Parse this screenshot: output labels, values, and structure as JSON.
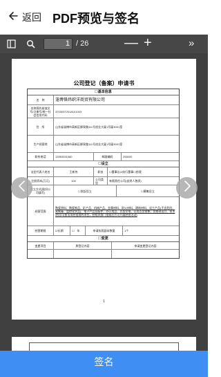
{
  "header": {
    "back_label": "返回",
    "title": "PDF预览与签名"
  },
  "toolbar": {
    "page_current": "1",
    "page_total": "/ 26",
    "zoom_out": "—",
    "zoom_in": "+",
    "more": "»"
  },
  "document": {
    "title": "公司登记（备案）申请书",
    "sections": {
      "basic": "☐基本信息",
      "establish": "☐设立",
      "change": "☐变更"
    },
    "rows": {
      "name": {
        "label": "名　称",
        "value": "淄博恪炜织洋商贸有限公司"
      },
      "credit": {
        "label": "名称预先核准文号/注册号/统一社会信用代码",
        "value": "370303T2018101003"
      },
      "residence": {
        "label": "住　所",
        "value": "山东省淄博市高新区柳泉路111号创业大厦1号厦3001室"
      },
      "business": {
        "label": "生产经营地",
        "value": "山东省淄博市高新区柳泉路111号创业大厦1号厦3001室"
      },
      "phone": {
        "label": "联系电话",
        "value": "13953331080",
        "postal_label": "邮政编码",
        "postal_value": "255000"
      },
      "legal_rep": {
        "label": "法定代表人姓名",
        "value": "王新伟",
        "role_label": "职务",
        "role_value": "☐董事长☑执行董事☐经理"
      },
      "capital": {
        "label": "注册资本(万元)",
        "value": "100",
        "type_label": "公司类型",
        "type_value": "有限责任公司(自然人独资)"
      },
      "method": {
        "label": "设立方式(股份公司填写)",
        "opt1": "☐发起设立",
        "opt2": "☐募集设立"
      },
      "scope": {
        "label": "经营范围",
        "value": "陶瓷原料、陶瓷制品、矿产品、机械产品、金属材料、耐火材料、建筑材料、化工产品(不含危险、易制毒、监控化学品)、电子产品及配件、办公用品、五金交电、日用百货销售；货物进出口、技术进出口(依法须经批准的项目，经相关部门批准后方可开展经营活动)"
      },
      "term": {
        "label": "经营期限",
        "opt1": "☑长期",
        "opt2": "☐　年",
        "copies_label": "申请执照副本数量",
        "copies_value": "1个"
      }
    },
    "change_header": [
      "变更项目",
      "原登记内容",
      "申请变更登记内容"
    ],
    "page_number": "1"
  },
  "sign_button": "签名",
  "colors": {
    "toolbar": "#474747",
    "viewer": "#404040",
    "sign_bar": "#3f8ef3"
  },
  "icons": [
    "back-arrow-icon",
    "sidebar-toggle-icon",
    "search-icon",
    "chevron-left-icon",
    "chevron-right-icon"
  ]
}
